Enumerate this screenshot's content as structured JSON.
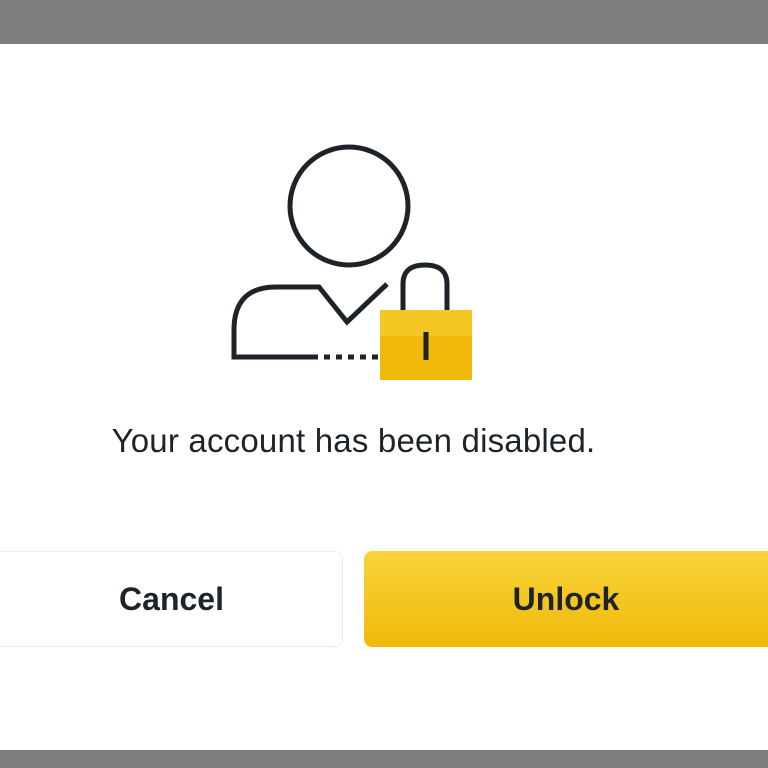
{
  "dialog": {
    "illustration_icon": "user-locked-icon",
    "message": "Your account has been disabled.",
    "cancel_label": "Cancel",
    "unlock_label": "Unlock"
  },
  "colors": {
    "backdrop": "#7d7d7d",
    "dialog_background": "#ffffff",
    "accent_yellow": "#f0b90b",
    "text_primary": "#1e2329",
    "cancel_border": "#eaecef"
  }
}
